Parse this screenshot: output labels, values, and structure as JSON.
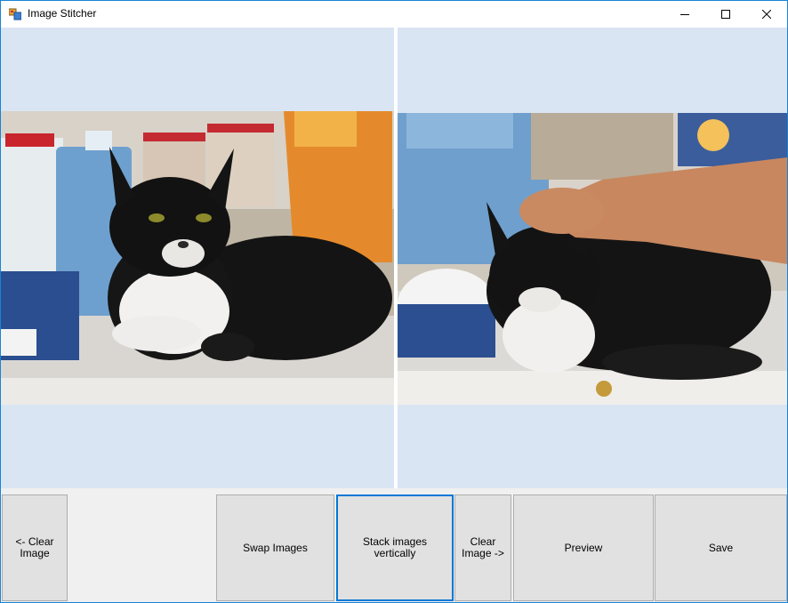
{
  "window": {
    "title": "Image Stitcher",
    "icon": "app-window-icon",
    "controls": {
      "minimize": "minimize-icon",
      "maximize": "maximize-icon",
      "close": "close-icon"
    }
  },
  "panels": {
    "left_image": "cat-photo-left",
    "right_image": "cat-photo-right"
  },
  "buttons": {
    "clear_left": "<- Clear Image",
    "swap": "Swap Images",
    "stack": "Stack images vertically",
    "clear_right": "Clear Image ->",
    "preview": "Preview",
    "save": "Save"
  },
  "colors": {
    "panel_bg": "#d9e5f3",
    "window_border": "#1883d7",
    "button_bg": "#e1e1e1",
    "focus_border": "#0078d7"
  }
}
